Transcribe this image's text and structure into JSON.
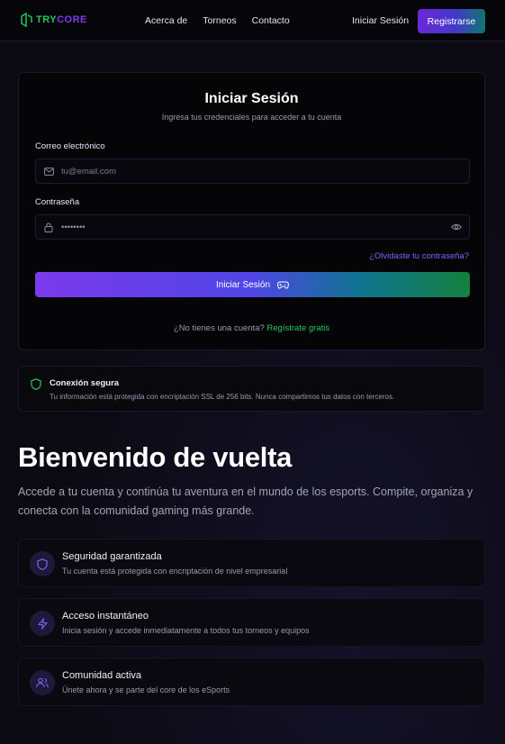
{
  "header": {
    "logo_part1": "TRY",
    "logo_part2": "CORE",
    "nav": [
      "Acerca de",
      "Torneos",
      "Contacto"
    ],
    "login": "Iniciar Sesión",
    "register": "Registrarse"
  },
  "login_card": {
    "title": "Iniciar Sesión",
    "subtitle": "Ingresa tus credenciales para acceder a tu cuenta",
    "email_label": "Correo electrónico",
    "email_placeholder": "tu@email.com",
    "password_label": "Contraseña",
    "password_value": "••••••••",
    "forgot": "¿Olvidaste tu contraseña?",
    "submit": "Iniciar Sesión",
    "no_account": "¿No tienes una cuenta?",
    "signup_link": "Regístrate gratis"
  },
  "secure": {
    "title": "Conexión segura",
    "text": "Tu información está protegida con encriptación SSL de 256 bits. Nunca compartimos tus datos con terceros."
  },
  "hero": {
    "title": "Bienvenido de vuelta",
    "text": "Accede a tu cuenta y continúa tu aventura en el mundo de los esports. Compite, organiza y conecta con la comunidad gaming más grande."
  },
  "features": [
    {
      "icon": "shield-icon",
      "title": "Seguridad garantizada",
      "desc": "Tu cuenta está protegida con encriptación de nivel empresarial"
    },
    {
      "icon": "lightning-icon",
      "title": "Acceso instantáneo",
      "desc": "Inicia sesión y accede inmediatamente a todos tus torneos y equipos"
    },
    {
      "icon": "users-icon",
      "title": "Comunidad activa",
      "desc": "Únete ahora y se parte del core de los eSports"
    }
  ],
  "colors": {
    "accent_purple": "#7c3aed",
    "accent_green": "#22c55e",
    "background": "#0b0a12"
  }
}
